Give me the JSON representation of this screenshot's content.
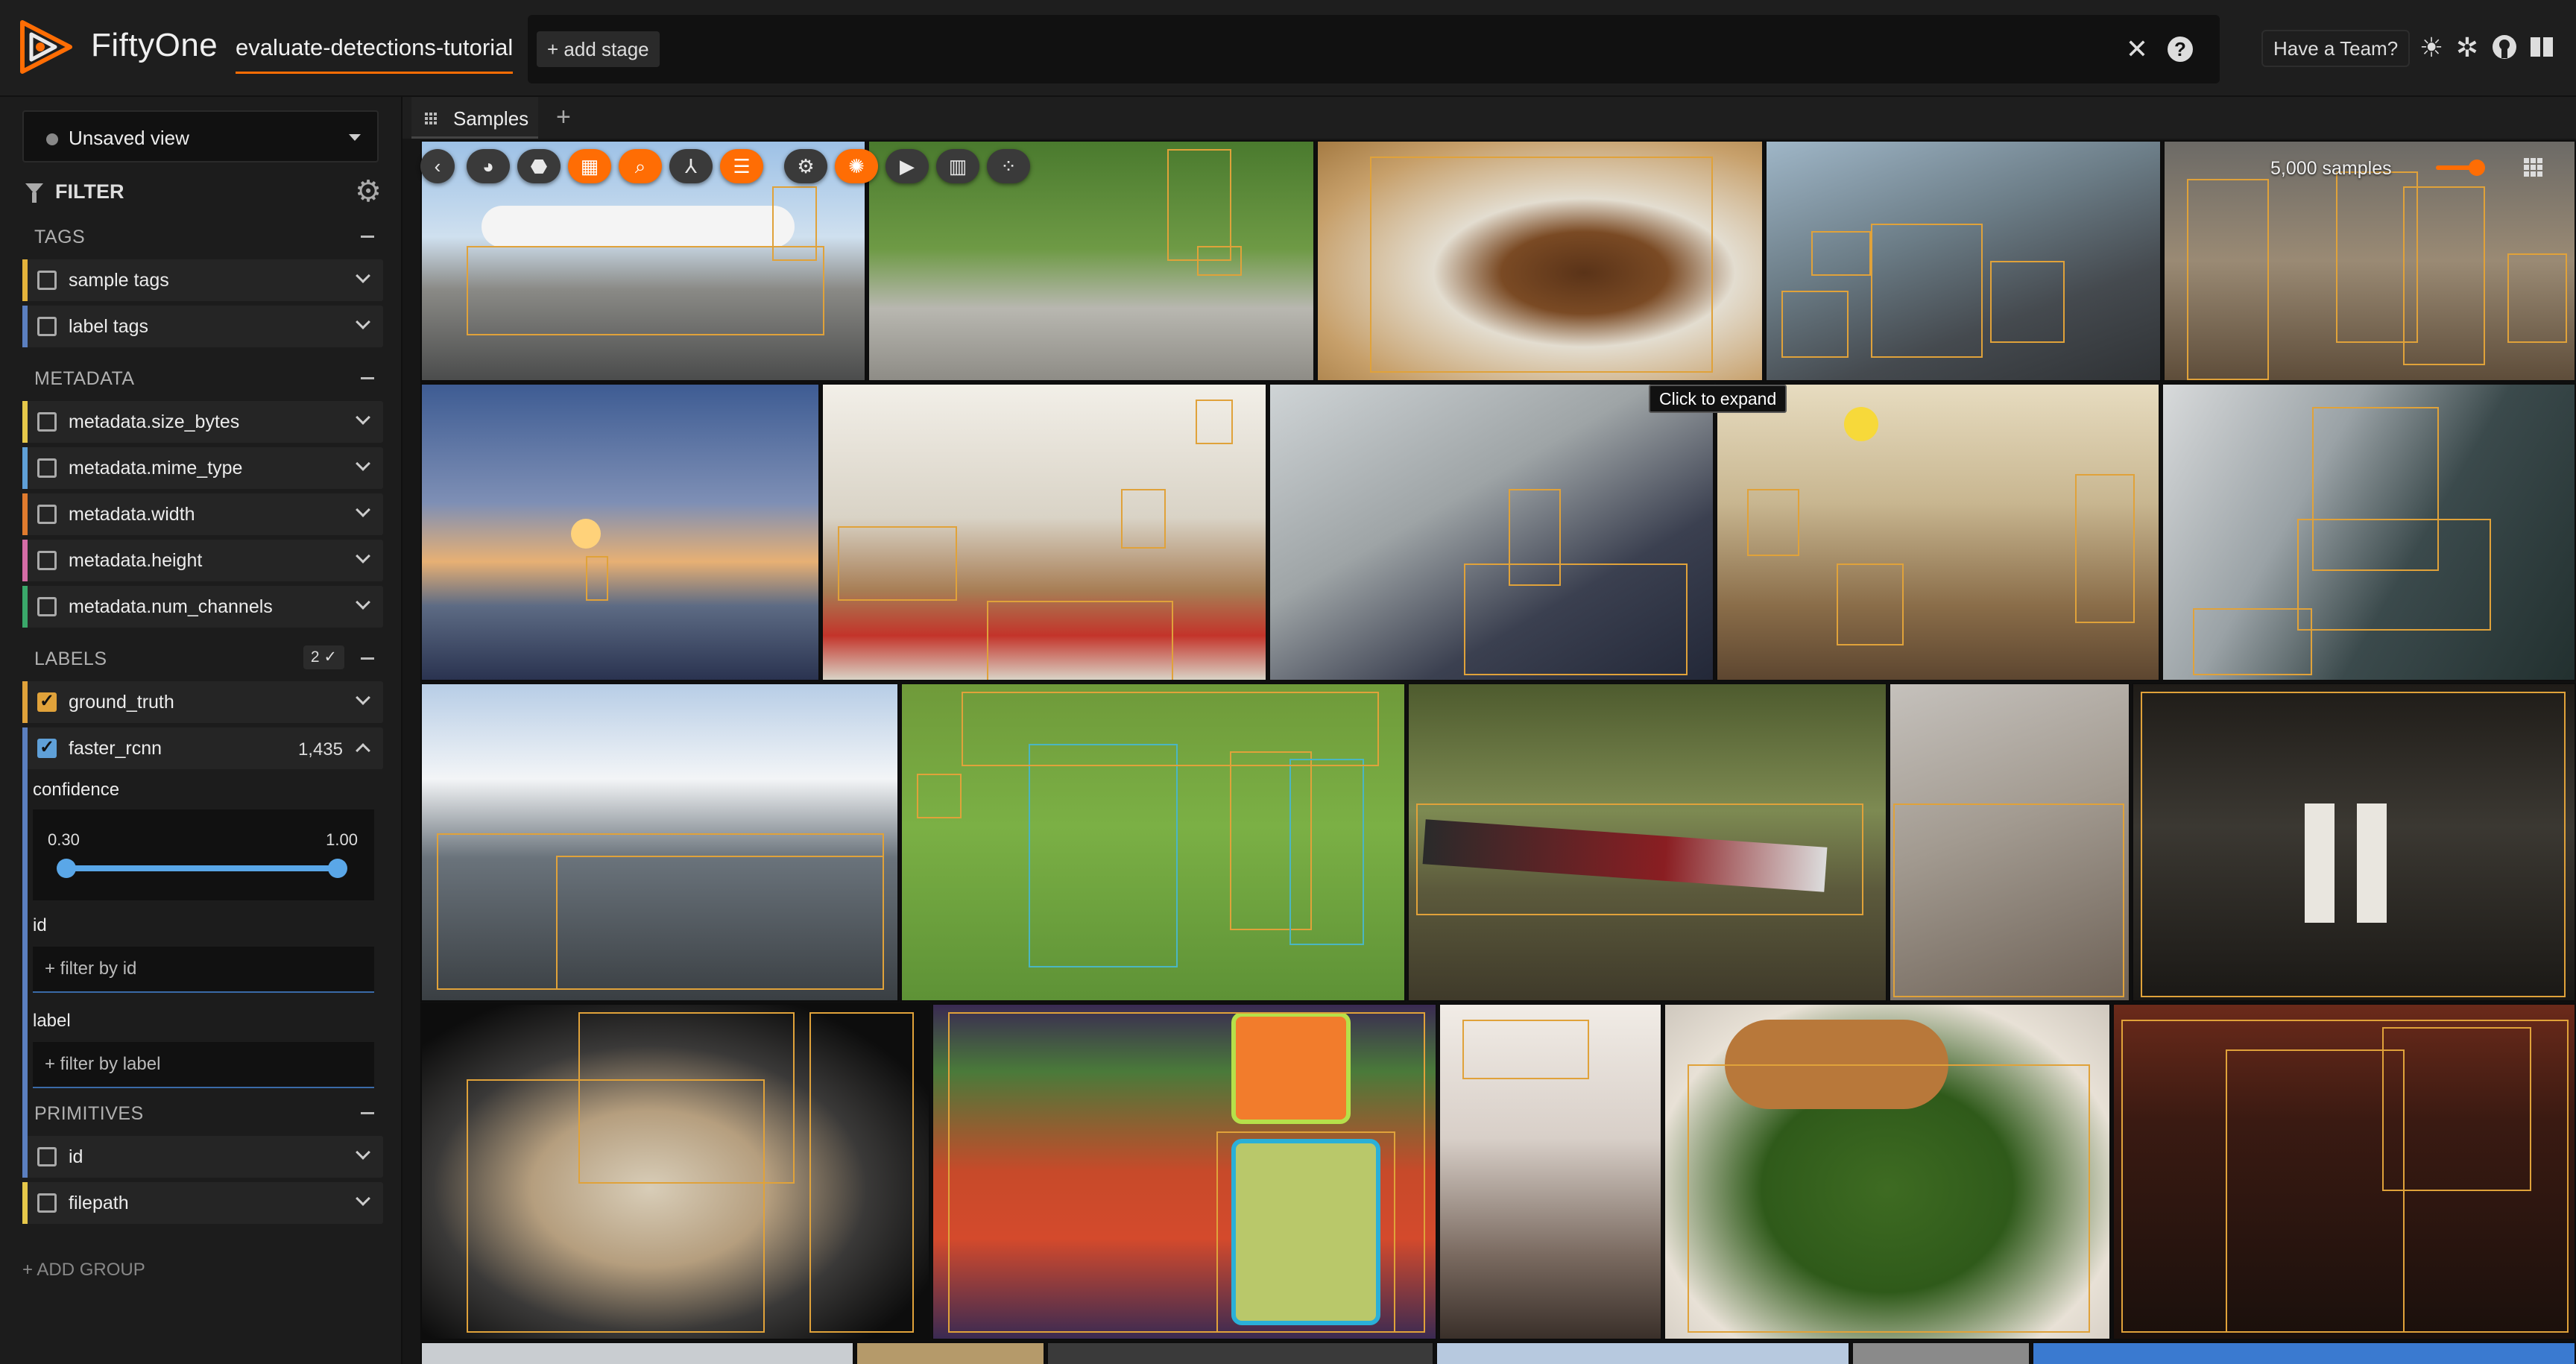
{
  "app": {
    "title": "FiftyOne",
    "dataset_name": "evaluate-detections-tutorial",
    "add_stage_label": "+ add stage",
    "team_label": "Have a Team?",
    "brand_color": "#ff6d04"
  },
  "header_icons": [
    "clear-icon",
    "help-icon",
    "theme-sun-icon",
    "slack-icon",
    "github-icon",
    "docs-book-icon"
  ],
  "sidebar": {
    "view_select": "Unsaved view",
    "filter_label": "FILTER",
    "groups": {
      "tags": "TAGS",
      "metadata": "METADATA",
      "labels": "LABELS",
      "labels_badge": "2 ✓",
      "primitives": "PRIMITIVES"
    },
    "fields": {
      "sample_tags": "sample tags",
      "label_tags": "label tags",
      "size_bytes": "metadata.size_bytes",
      "mime_type": "metadata.mime_type",
      "width": "metadata.width",
      "height": "metadata.height",
      "num_channels": "metadata.num_channels",
      "ground_truth": "ground_truth",
      "faster_rcnn": "faster_rcnn",
      "faster_rcnn_count": "1,435",
      "id": "id",
      "filepath": "filepath"
    },
    "field_colors": {
      "sample_tags": "#e4b33b",
      "label_tags": "#5b7fc0",
      "size_bytes": "#e6c84a",
      "mime_type": "#5fa0d8",
      "width": "#e07b2e",
      "height": "#d56ca6",
      "num_channels": "#3aa86a",
      "ground_truth": "#e0a23a",
      "faster_rcnn": "#5b7fc0",
      "id": "#5b7fc0",
      "filepath": "#e6c84a"
    },
    "faster_rcnn_panel": {
      "confidence_label": "confidence",
      "conf_min": "0.30",
      "conf_max": "1.00",
      "id_label": "id",
      "id_placeholder": "+ filter by id",
      "label_label": "label",
      "label_placeholder": "+ filter by label"
    },
    "add_group": "+ ADD GROUP"
  },
  "main": {
    "tab_label": "Samples",
    "sample_count": "5,000 samples",
    "tooltip": "Click to expand"
  }
}
